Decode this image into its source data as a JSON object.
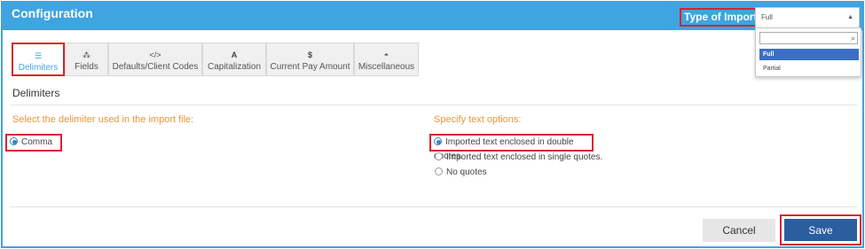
{
  "header": {
    "title": "Configuration",
    "import_label": "Type of Import:",
    "select_value": "Full"
  },
  "dropdown": {
    "search_value": "",
    "options": [
      "Full",
      "Partial"
    ],
    "selected": "Full"
  },
  "tabs": [
    {
      "label": "Delimiters",
      "icon": "list-icon",
      "active": true
    },
    {
      "label": "Fields",
      "icon": "sitemap-icon",
      "active": false
    },
    {
      "label": "Defaults/Client Codes",
      "icon": "code-icon",
      "active": false
    },
    {
      "label": "Capitalization",
      "icon": "A",
      "active": false
    },
    {
      "label": "Current Pay Amount",
      "icon": "$",
      "active": false
    },
    {
      "label": "Miscellaneous",
      "icon": "dashboard-icon",
      "active": false
    }
  ],
  "section_title": "Delimiters",
  "delimiter": {
    "heading": "Select the delimiter used in the import file:",
    "options": [
      {
        "label": "Comma",
        "checked": true
      }
    ]
  },
  "text_options": {
    "heading": "Specify text options:",
    "options": [
      {
        "label": "Imported text enclosed in double quotes.",
        "checked": true
      },
      {
        "label": "Imported text enclosed in single quotes.",
        "checked": false
      },
      {
        "label": "No quotes",
        "checked": false
      }
    ]
  },
  "footer": {
    "cancel_label": "Cancel",
    "save_label": "Save"
  },
  "colors": {
    "header": "#3fa4df",
    "accent_orange": "#e8963c",
    "save": "#2b5e9e",
    "highlight": "#d9232d"
  }
}
